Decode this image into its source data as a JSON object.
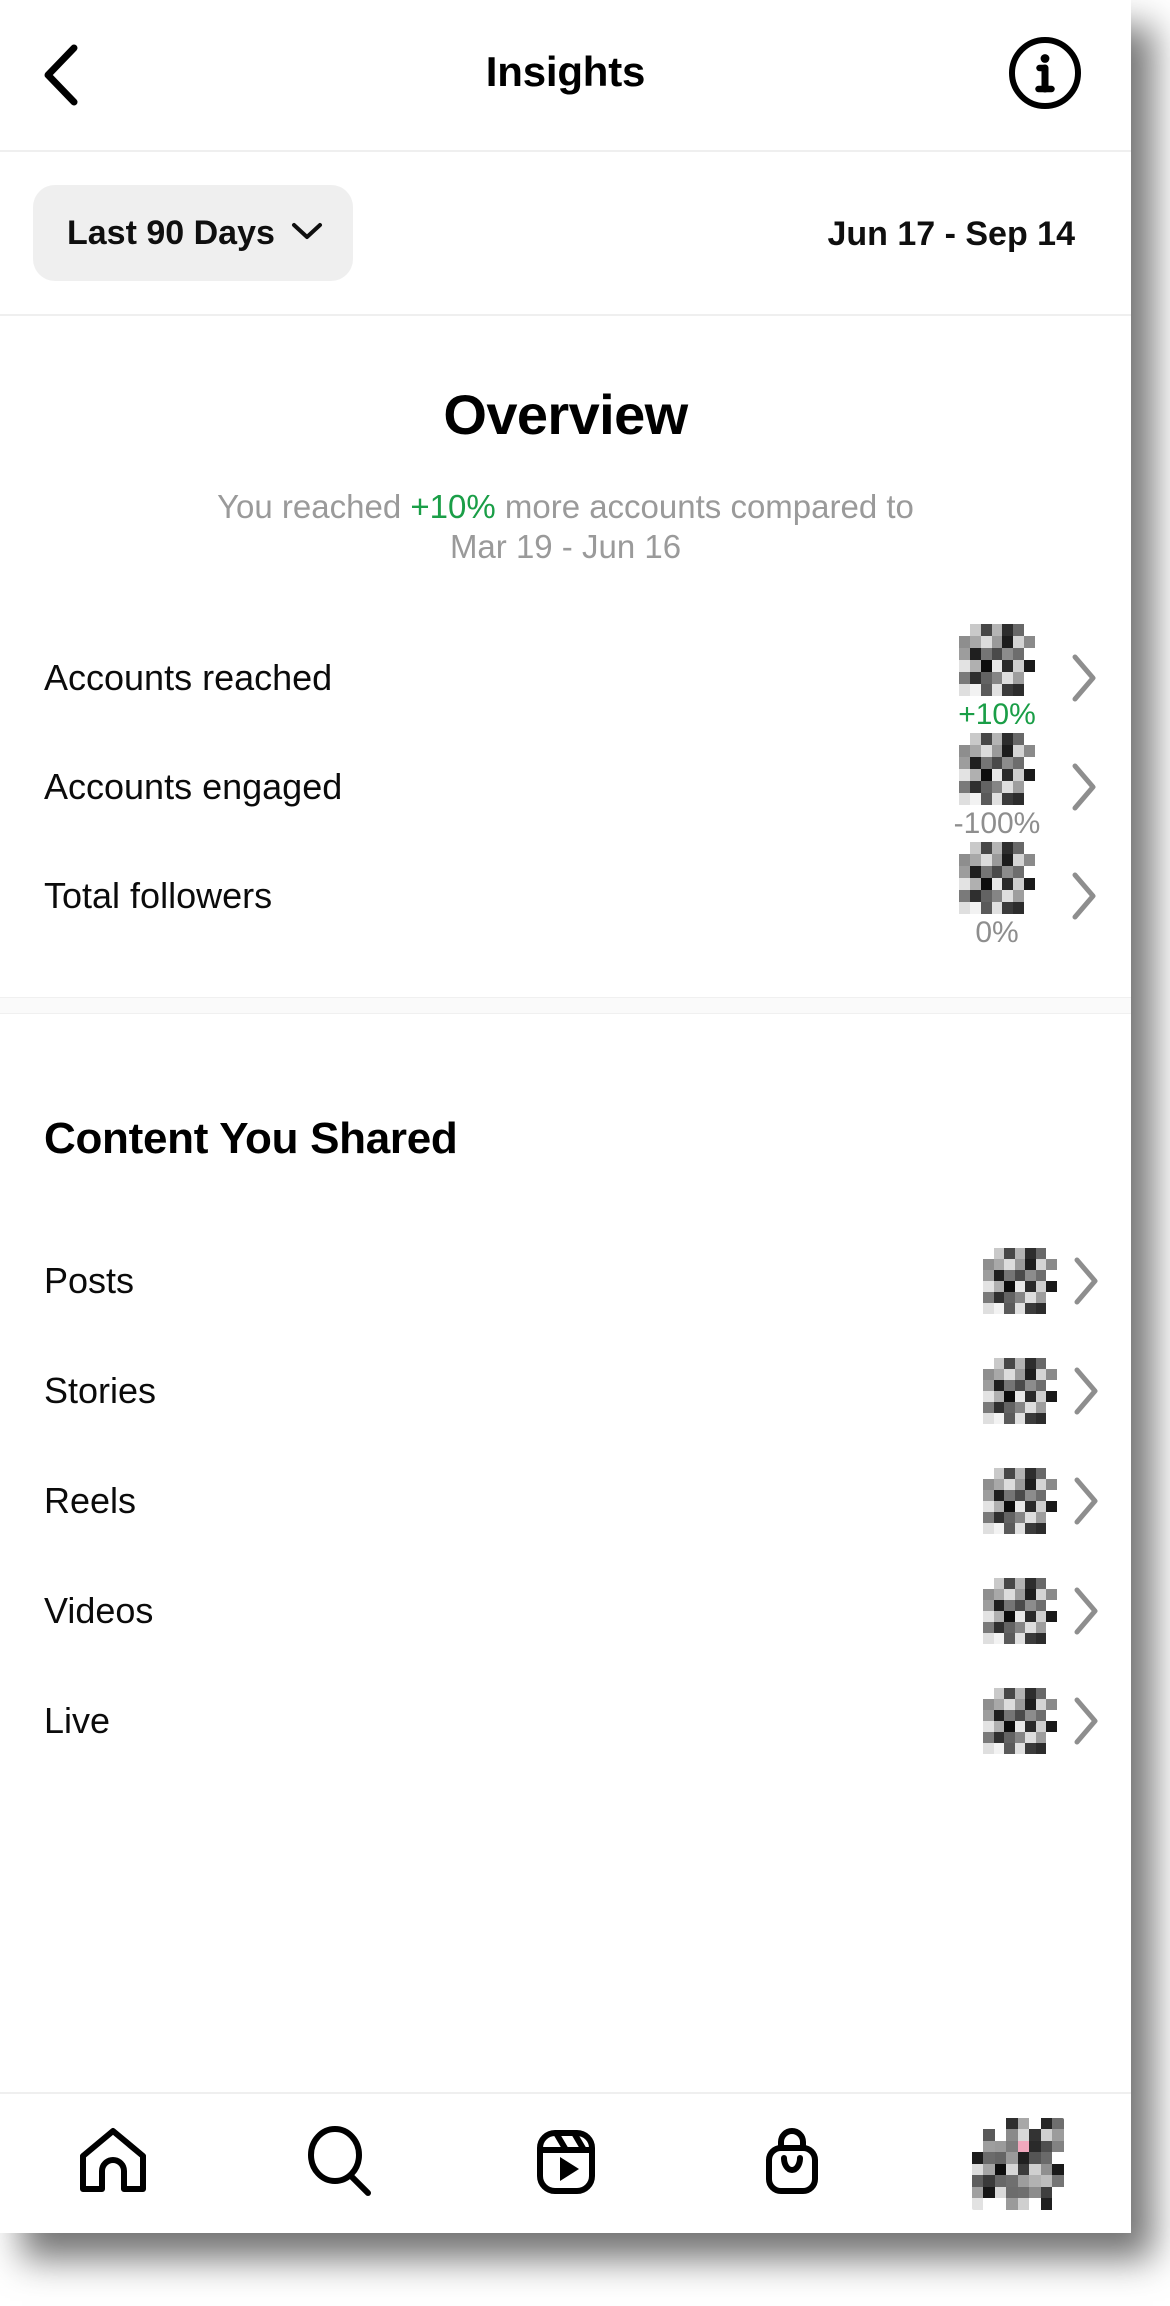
{
  "header": {
    "back_icon": "chevron-left-icon",
    "title": "Insights",
    "info_icon": "info-circle-icon"
  },
  "date_bar": {
    "range_label": "Last 90 Days",
    "range_chevron_icon": "chevron-down-icon",
    "date_range": "Jun 17 - Sep 14"
  },
  "overview": {
    "title": "Overview",
    "summary_prefix": "You reached ",
    "summary_accent": "+10%",
    "summary_suffix": " more accounts compared to",
    "summary_compare_range": "Mar 19 - Jun 16",
    "accent_color": "#1a9e47",
    "muted_color": "#9a9a9a",
    "metrics": [
      {
        "label": "Accounts reached",
        "value": "redacted",
        "delta": "+10%",
        "delta_tone": "positive",
        "chevron_icon": "chevron-right-icon"
      },
      {
        "label": "Accounts engaged",
        "value": "redacted",
        "delta": "-100%",
        "delta_tone": "neutral",
        "chevron_icon": "chevron-right-icon"
      },
      {
        "label": "Total followers",
        "value": "redacted",
        "delta": "0%",
        "delta_tone": "neutral",
        "chevron_icon": "chevron-right-icon"
      }
    ]
  },
  "content_shared": {
    "title": "Content You Shared",
    "items": [
      {
        "label": "Posts",
        "value": "redacted",
        "chevron_icon": "chevron-right-icon"
      },
      {
        "label": "Stories",
        "value": "redacted",
        "chevron_icon": "chevron-right-icon"
      },
      {
        "label": "Reels",
        "value": "redacted",
        "chevron_icon": "chevron-right-icon"
      },
      {
        "label": "Videos",
        "value": "redacted",
        "chevron_icon": "chevron-right-icon"
      },
      {
        "label": "Live",
        "value": "redacted",
        "chevron_icon": "chevron-right-icon"
      }
    ]
  },
  "bottom_nav": {
    "items": [
      {
        "name": "home-icon"
      },
      {
        "name": "search-icon"
      },
      {
        "name": "reels-icon"
      },
      {
        "name": "shop-bag-icon"
      },
      {
        "name": "profile-avatar"
      }
    ]
  }
}
